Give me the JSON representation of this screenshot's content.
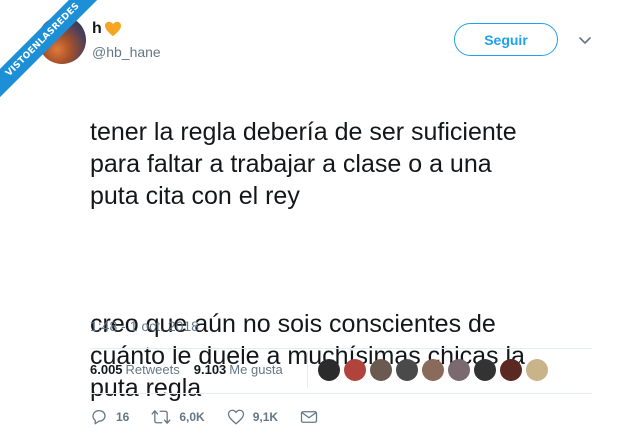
{
  "watermark": {
    "text": "VISTOENLASREDES"
  },
  "user": {
    "name": "h",
    "name_emoji": "orange-heart",
    "handle": "@hb_hane"
  },
  "header": {
    "follow_label": "Seguir"
  },
  "tweet": {
    "paragraph_1": "tener la regla debería de ser suficiente\npara faltar a trabajar a clase o a una\nputa cita con el rey",
    "paragraph_2": "creo que aún no sois conscientes de\ncuánto le duele a muchísimas chicas la\nputa regla",
    "timestamp": "1:48 - 1 oct. 2018"
  },
  "stats": {
    "retweets_count": "6.005",
    "retweets_label": "Retweets",
    "likes_count": "9.103",
    "likes_label": "Me gusta"
  },
  "likers": [
    {
      "color": "#2b2b2b"
    },
    {
      "color": "#b0443c"
    },
    {
      "color": "#6b5a50"
    },
    {
      "color": "#4a4a4a"
    },
    {
      "color": "#8a6a5a"
    },
    {
      "color": "#7a6a70"
    },
    {
      "color": "#333333"
    },
    {
      "color": "#5a2a22"
    },
    {
      "color": "#c9b48a"
    }
  ],
  "actions": {
    "replies": "16",
    "retweets": "6,0K",
    "likes": "9,1K"
  },
  "colors": {
    "accent": "#1da1f2",
    "muted": "#657786",
    "ribbon": "#1d8fd6"
  }
}
